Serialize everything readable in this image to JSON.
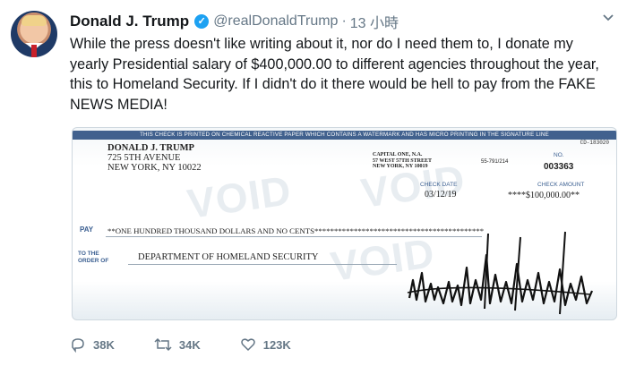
{
  "tweet": {
    "name": "Donald J. Trump",
    "handle": "@realDonaldTrump",
    "separator": "·",
    "time": "13 小時",
    "text": "While the press doesn't like writing about it, nor do I need them to, I donate my yearly Presidential salary of $400,000.00 to different agencies throughout the year, this to Homeland Security. If I didn't do it there would be hell to pay from the FAKE NEWS MEDIA!"
  },
  "check": {
    "security_strip": "THIS CHECK IS PRINTED ON CHEMICAL REACTIVE PAPER WHICH CONTAINS A WATERMARK AND HAS MICRO PRINTING IN THE SIGNATURE LINE",
    "check_id": "CD-183020",
    "owner_name": "DONALD J. TRUMP",
    "owner_street": "725 5TH AVENUE",
    "owner_city": "NEW YORK, NY 10022",
    "bank_name": "CAPITAL ONE, N.A.",
    "bank_street": "57 WEST 57TH STREET",
    "bank_city": "NEW YORK, NY 10019",
    "routing": "55-791/214",
    "no_label": "NO.",
    "number": "003363",
    "date_label": "CHECK DATE",
    "date": "03/12/19",
    "amount_label": "CHECK AMOUNT",
    "amount": "****$100,000.00**",
    "pay_label": "PAY",
    "pay_text": "**ONE HUNDRED THOUSAND DOLLARS AND NO CENTS*******************************************",
    "order_label_1": "TO THE",
    "order_label_2": "ORDER OF",
    "payee": "DEPARTMENT OF HOMELAND SECURITY",
    "watermark": "VOID"
  },
  "actions": {
    "replies": "38K",
    "retweets": "34K",
    "likes": "123K"
  },
  "colors": {
    "verified": "#1da1f2",
    "muted": "#657786",
    "strip": "#41618e"
  }
}
